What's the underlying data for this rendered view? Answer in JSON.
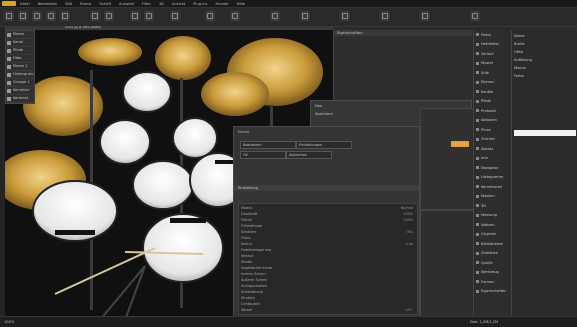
{
  "menubar": {
    "items": [
      "Datei",
      "Bearbeiten",
      "Bild",
      "Ebene",
      "Schrift",
      "Auswahl",
      "Filter",
      "3D",
      "Ansicht",
      "Plug-ins",
      "Fenster",
      "Hilfe"
    ]
  },
  "layers_panel": {
    "items": [
      "Ebene",
      "Kanal",
      "Pfade",
      "Filter",
      "Ebene 1",
      "Hintergrund",
      "Gruppe 1",
      "Korrektur",
      "Kontrast"
    ]
  },
  "canvas": {
    "tab_label": "drums.jpg @ 100% (RGB/8)"
  },
  "top_panel": {
    "title": "Eigenschaften"
  },
  "small_dialog": {
    "line1": "Neu",
    "line2": "Speichern"
  },
  "dialog": {
    "title": "Ebene",
    "field1": "Bearbeiten",
    "field2": "Einstellungen",
    "btn_ok": "OK",
    "btn_cancel": "Abbrechen",
    "header": "Einstellung",
    "rows": [
      {
        "label": "Modus",
        "value": "Normal"
      },
      {
        "label": "Deckkraft",
        "value": "100%"
      },
      {
        "label": "Fläche",
        "value": "100%"
      },
      {
        "label": "Füllmethode",
        "value": ""
      },
      {
        "label": "Schatten",
        "value": "75%"
      },
      {
        "label": "Glanz",
        "value": ""
      },
      {
        "label": "Kontur",
        "value": "3 px"
      },
      {
        "label": "Farbüberlagerung",
        "value": ""
      },
      {
        "label": "Verlauf",
        "value": ""
      },
      {
        "label": "Muster",
        "value": ""
      },
      {
        "label": "Abgeflachte Kante",
        "value": ""
      },
      {
        "label": "Innerer Schein",
        "value": ""
      },
      {
        "label": "Äußerer Schein",
        "value": ""
      },
      {
        "label": "Schlagschatten",
        "value": ""
      },
      {
        "label": "Schattierung",
        "value": ""
      },
      {
        "label": "Struktur",
        "value": ""
      },
      {
        "label": "Lichtquelle",
        "value": ""
      },
      {
        "label": "Winkel",
        "value": "120°"
      }
    ]
  },
  "right_panel": {
    "items": [
      "Farbe",
      "Farbfelder",
      "Verlauf",
      "Muster",
      "Stile",
      "Ebenen",
      "Kanäle",
      "Pfade",
      "Protokoll",
      "Aktionen",
      "Pinsel",
      "Zeichen",
      "Absatz",
      "Info",
      "Navigator",
      "Histogramm",
      "Korrekturen",
      "Masken",
      "3D",
      "Messung",
      "Notizen",
      "Glyphen",
      "Bibliotheken",
      "Zeitleiste",
      "Quelle",
      "Werkzeug",
      "Formen",
      "Eigenschaften"
    ]
  },
  "right2_panel": {
    "items": [
      "Name",
      "Breite",
      "Höhe",
      "Auflösung",
      "Modus",
      "Farbe"
    ],
    "accent": "#e6a23c"
  },
  "status": {
    "zoom": "100%",
    "doc": "Dok: 1,2M/1,2M"
  }
}
